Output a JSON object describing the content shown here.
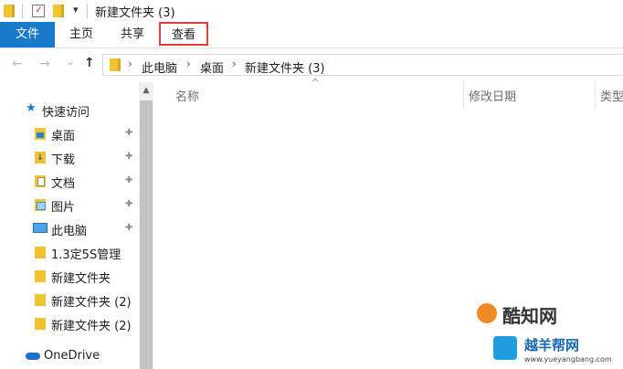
{
  "window": {
    "title": "新建文件夹 (3)"
  },
  "quick_access_toolbar": {
    "dropdown_glyph": "▾"
  },
  "ribbon": {
    "tabs": [
      {
        "label": "文件",
        "active": true
      },
      {
        "label": "主页"
      },
      {
        "label": "共享"
      },
      {
        "label": "查看",
        "highlighted": true
      }
    ]
  },
  "navigation": {
    "back": "←",
    "forward": "→",
    "recent": "⌄",
    "up": "↑"
  },
  "address": {
    "breadcrumb": [
      "此电脑",
      "桌面",
      "新建文件夹 (3)"
    ],
    "separator": "›"
  },
  "nav_pane": {
    "quick_access_label": "快速访问",
    "items": [
      {
        "label": "桌面",
        "pinned": true,
        "icon": "desktop-folder-icon"
      },
      {
        "label": "下载",
        "pinned": true,
        "icon": "download-folder-icon"
      },
      {
        "label": "文档",
        "pinned": true,
        "icon": "documents-folder-icon"
      },
      {
        "label": "图片",
        "pinned": true,
        "icon": "pictures-folder-icon"
      },
      {
        "label": "此电脑",
        "pinned": true,
        "icon": "this-pc-icon"
      },
      {
        "label": "1.3定5S管理",
        "icon": "folder-icon"
      },
      {
        "label": "新建文件夹",
        "icon": "folder-icon"
      },
      {
        "label": "新建文件夹 (2)",
        "icon": "folder-icon"
      },
      {
        "label": "新建文件夹 (2)",
        "icon": "folder-icon"
      }
    ],
    "onedrive_label": "OneDrive",
    "pin_glyph": "📌"
  },
  "content": {
    "columns": [
      "名称",
      "修改日期",
      "类型"
    ],
    "sort_glyph": "^"
  },
  "watermark": {
    "brand1": "酷知网",
    "brand2": "越羊帮网",
    "url": "www.yueyangbang.com"
  },
  "colors": {
    "file_tab": "#1979ca",
    "highlight_border": "#d9413a",
    "folder": "#f1c232"
  }
}
